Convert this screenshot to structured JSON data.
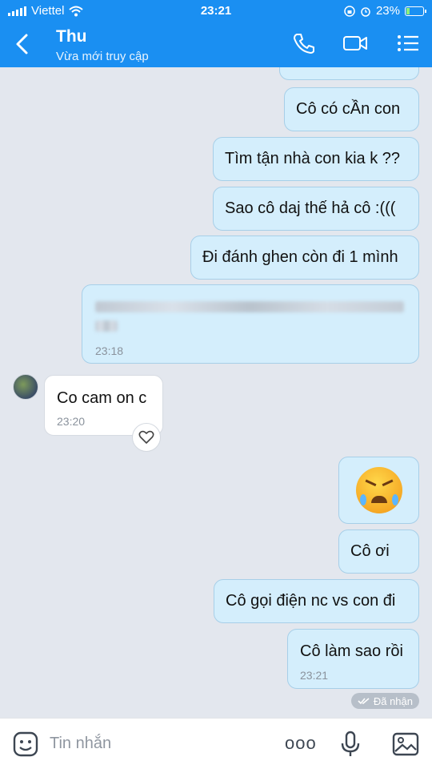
{
  "status": {
    "carrier": "Viettel",
    "time": "23:21",
    "battery": "23%",
    "battery_level": 0.23
  },
  "header": {
    "name": "Thu",
    "subtitle": "Vừa mới truy cập"
  },
  "messages": {
    "m1": {
      "text": "Cô có cẦn con"
    },
    "m2": {
      "text": "Tìm tận nhà con kia k ??"
    },
    "m3": {
      "text": "Sao cô daj thế hả cô :((("
    },
    "m4": {
      "text": "Đi đánh ghen còn đi 1 mình"
    },
    "m5": {
      "time": "23:18"
    },
    "r1": {
      "text": "Co cam on c",
      "time": "23:20"
    },
    "m7": {
      "text": "Cô ơi"
    },
    "m8": {
      "text": "Cô gọi điện nc vs con đi"
    },
    "m9": {
      "text": "Cô làm sao rồi",
      "time": "23:21"
    }
  },
  "delivery_status": "Đã nhận",
  "composer": {
    "placeholder": "Tin nhắn",
    "more_label": "ooo"
  },
  "colors": {
    "header": "#1a8ff2",
    "my_bubble": "#d4eefc",
    "background": "#e3e7ee"
  }
}
